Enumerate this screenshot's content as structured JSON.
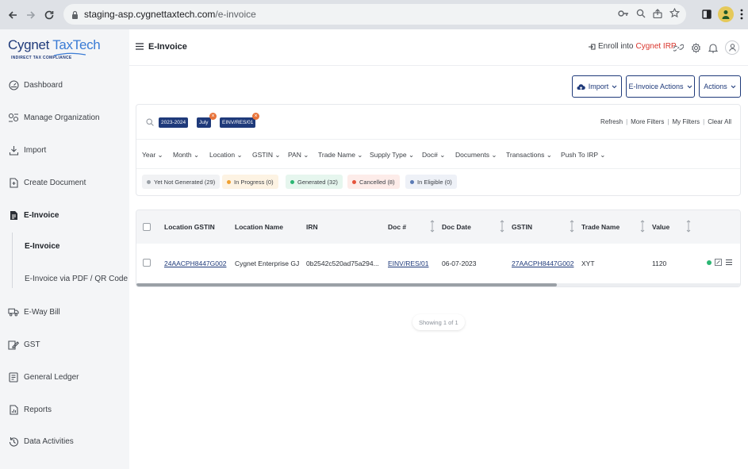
{
  "browser": {
    "url_host": "staging-asp.cygnettaxtech.com",
    "url_path": "/e-invoice"
  },
  "brand": {
    "name_bold": "Cygnet",
    "name_light": "TaxTech",
    "tagline": "INDIRECT TAX COMPLIANCE"
  },
  "sidebar": {
    "items": [
      {
        "label": "Dashboard",
        "icon": "dashboard-icon"
      },
      {
        "label": "Manage Organization",
        "icon": "organization-icon"
      },
      {
        "label": "Import",
        "icon": "import-icon"
      },
      {
        "label": "Create Document",
        "icon": "document-icon"
      },
      {
        "label": "E-Invoice",
        "icon": "einvoice-icon"
      },
      {
        "label": "E-Way Bill",
        "icon": "truck-icon"
      },
      {
        "label": "GST",
        "icon": "gst-icon"
      },
      {
        "label": "General Ledger",
        "icon": "ledger-icon"
      },
      {
        "label": "Reports",
        "icon": "reports-icon"
      },
      {
        "label": "Data Activities",
        "icon": "history-icon"
      }
    ],
    "sub_items": [
      {
        "label": "E-Invoice"
      },
      {
        "label": "E-Invoice via PDF / QR Code"
      }
    ]
  },
  "header": {
    "title": "E-Invoice",
    "enroll_text": "Enroll into",
    "enroll_highlight": "Cygnet IRP"
  },
  "actions": {
    "import": "Import",
    "einvoice_actions": "E-Invoice Actions",
    "actions": "Actions"
  },
  "filters": {
    "chips": [
      "2023-2024",
      "July",
      "EINV/RES/01"
    ],
    "links": [
      "Refresh",
      "More Filters",
      "My Filters",
      "Clear All"
    ],
    "dropdowns": [
      "Year",
      "Month",
      "Location",
      "GSTIN",
      "PAN",
      "Trade Name",
      "Supply Type",
      "Doc#",
      "Documents",
      "Transactions",
      "Push To IRP"
    ],
    "statuses": [
      {
        "label": "Yet Not Generated (29)",
        "color": "#9aa0a6",
        "bg": "#f1f2f4"
      },
      {
        "label": "In Progress (0)",
        "color": "#f0a030",
        "bg": "#fdf3e3"
      },
      {
        "label": "Generated (32)",
        "color": "#2bb673",
        "bg": "#e6f6ee"
      },
      {
        "label": "Cancelled (8)",
        "color": "#e5533c",
        "bg": "#fdece9"
      },
      {
        "label": "In Eligible (0)",
        "color": "#5b7bb5",
        "bg": "#eef1f7"
      }
    ]
  },
  "table": {
    "columns": [
      "Location GSTIN",
      "Location Name",
      "IRN",
      "Doc #",
      "Doc Date",
      "GSTIN",
      "Trade Name",
      "Value"
    ],
    "rows": [
      {
        "location_gstin": "24AACPH8447G002",
        "location_name": "Cygnet Enterprise GJ",
        "irn": "0b2542c520ad75a294...",
        "doc_no": "EINV/RES/01",
        "doc_date": "06-07-2023",
        "gstin": "27AACPH8447G002",
        "trade_name": "XYT",
        "value": "1120"
      }
    ],
    "status_color": "#2bb673"
  },
  "pagination": {
    "text": "Showing 1 of 1"
  }
}
